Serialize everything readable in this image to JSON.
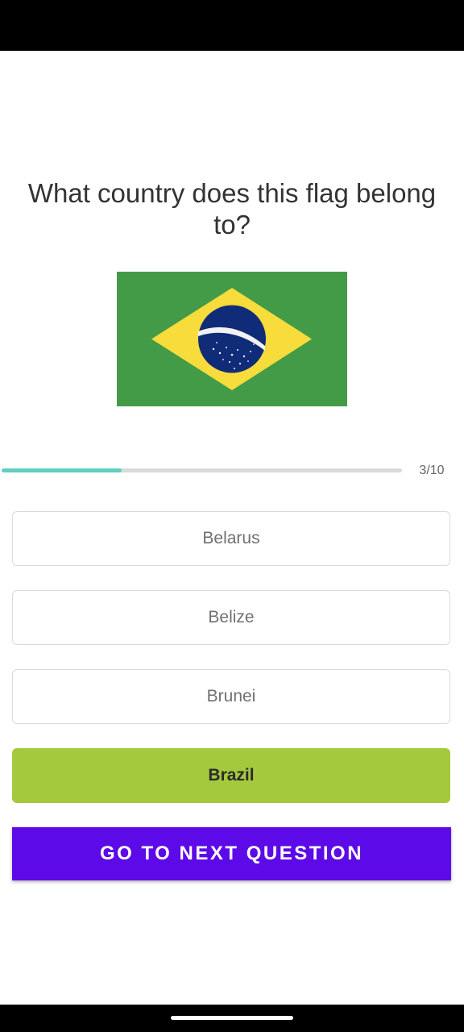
{
  "quiz": {
    "question": "What country does this flag belong to?",
    "flag_icon": "brazil-flag-icon",
    "progress": {
      "current": 3,
      "total": 10,
      "label": "3/10",
      "fraction": 0.3
    },
    "options": [
      {
        "label": "Belarus",
        "state": "default"
      },
      {
        "label": "Belize",
        "state": "default"
      },
      {
        "label": "Brunei",
        "state": "default"
      },
      {
        "label": "Brazil",
        "state": "correct"
      }
    ],
    "next_button_label": "GO TO NEXT QUESTION"
  },
  "colors": {
    "progress_fill": "#5fd0c0",
    "progress_track": "#d9d9d9",
    "correct_option": "#a4c93d",
    "next_button": "#5d0ae8",
    "flag_green": "#439b47",
    "flag_yellow": "#f7dc3b",
    "flag_blue": "#102c79"
  }
}
